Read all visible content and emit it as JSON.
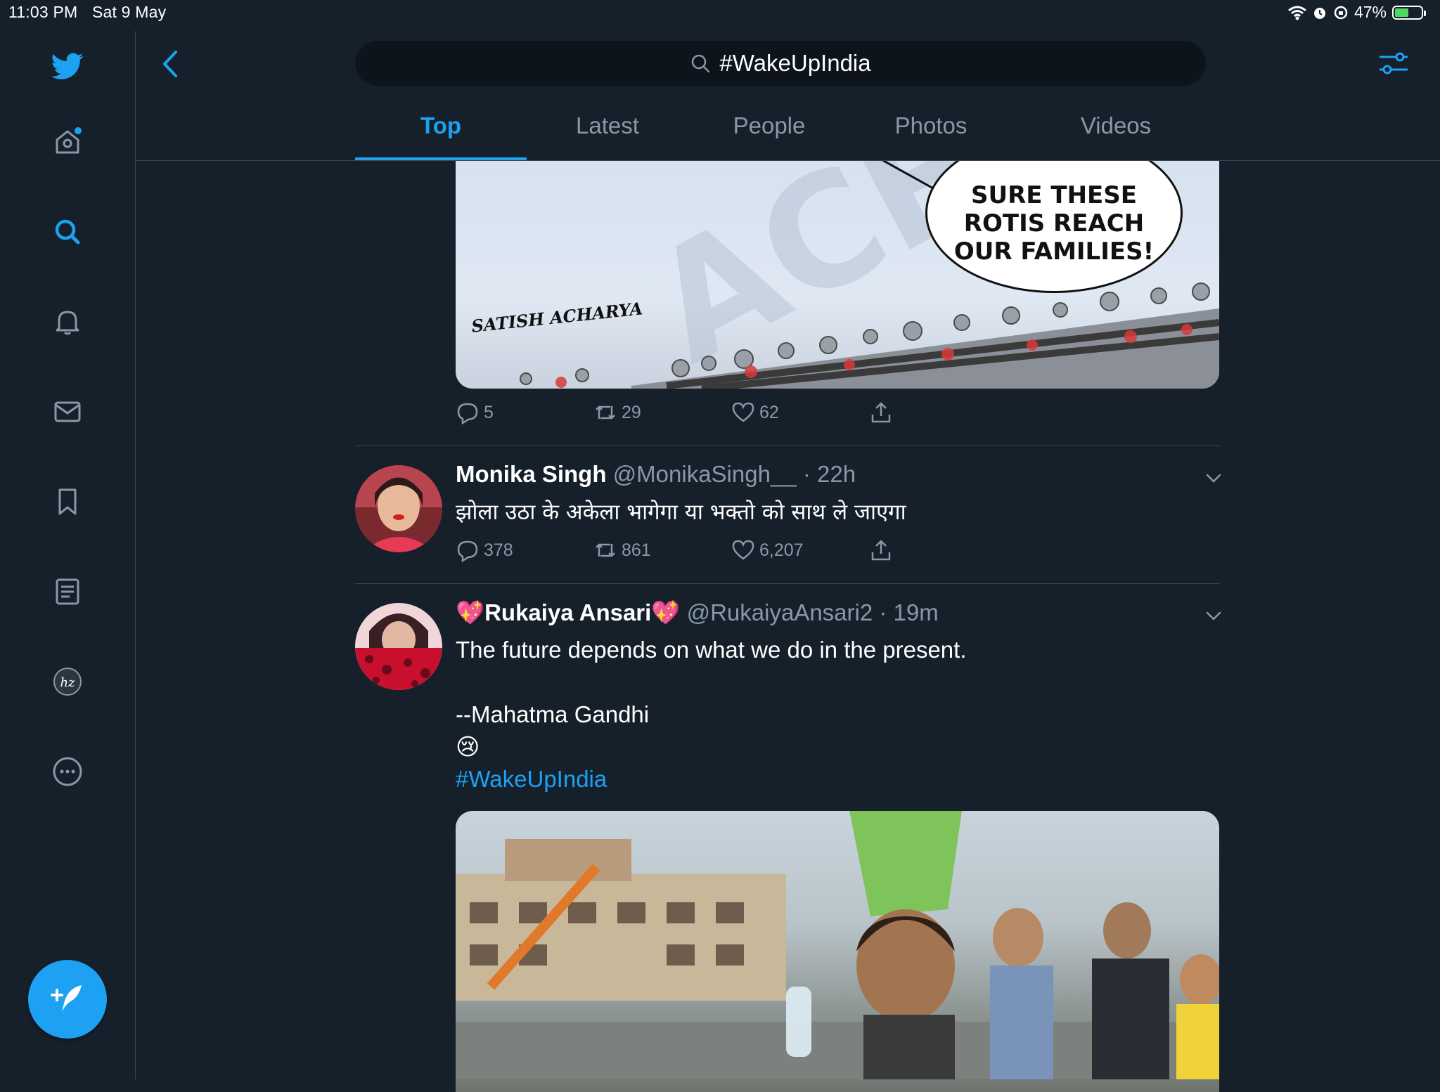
{
  "status_bar": {
    "time": "11:03 PM",
    "date": "Sat 9 May",
    "battery": "47%",
    "battery_level": 0.47,
    "icons": [
      "wifi-icon",
      "alarm-icon",
      "rotation-lock-icon",
      "battery-icon"
    ]
  },
  "sidebar": {
    "items": [
      {
        "name": "twitter-logo-icon"
      },
      {
        "name": "home-icon"
      },
      {
        "name": "explore-icon"
      },
      {
        "name": "notifications-icon"
      },
      {
        "name": "messages-icon"
      },
      {
        "name": "bookmarks-icon"
      },
      {
        "name": "lists-icon"
      },
      {
        "name": "profile-icon"
      },
      {
        "name": "more-icon"
      }
    ],
    "compose": "compose-tweet-icon"
  },
  "header": {
    "search_query": "#WakeUpIndia",
    "tabs": [
      "Top",
      "Latest",
      "People",
      "Photos",
      "Videos"
    ],
    "active_tab": "Top"
  },
  "colors": {
    "background": "#15202b",
    "accent": "#1da1f2",
    "muted": "#8899a6",
    "divider": "#38444d"
  },
  "tweets": [
    {
      "media_text": "SURE THESE ROTIS REACH OUR FAMILIES!",
      "media_signature": "SATISH ACHARYA",
      "replies": "5",
      "retweets": "29",
      "likes": "62"
    },
    {
      "name": "Monika Singh",
      "handle": "@MonikaSingh__",
      "time": "22h",
      "text": "झोला उठा के अकेला भागेगा या भक्तो को साथ ले जाएगा",
      "replies": "378",
      "retweets": "861",
      "likes": "6,207"
    },
    {
      "name_prefix_emoji": "💖",
      "name": "Rukaiya Ansari",
      "name_suffix_emoji": "💖",
      "handle": "@RukaiyaAnsari2",
      "time": "19m",
      "text_line1": "The future depends on what we do in the present.",
      "text_line2": "--Mahatma Gandhi",
      "emoji": "😢",
      "hashtag": "#WakeUpIndia"
    }
  ]
}
